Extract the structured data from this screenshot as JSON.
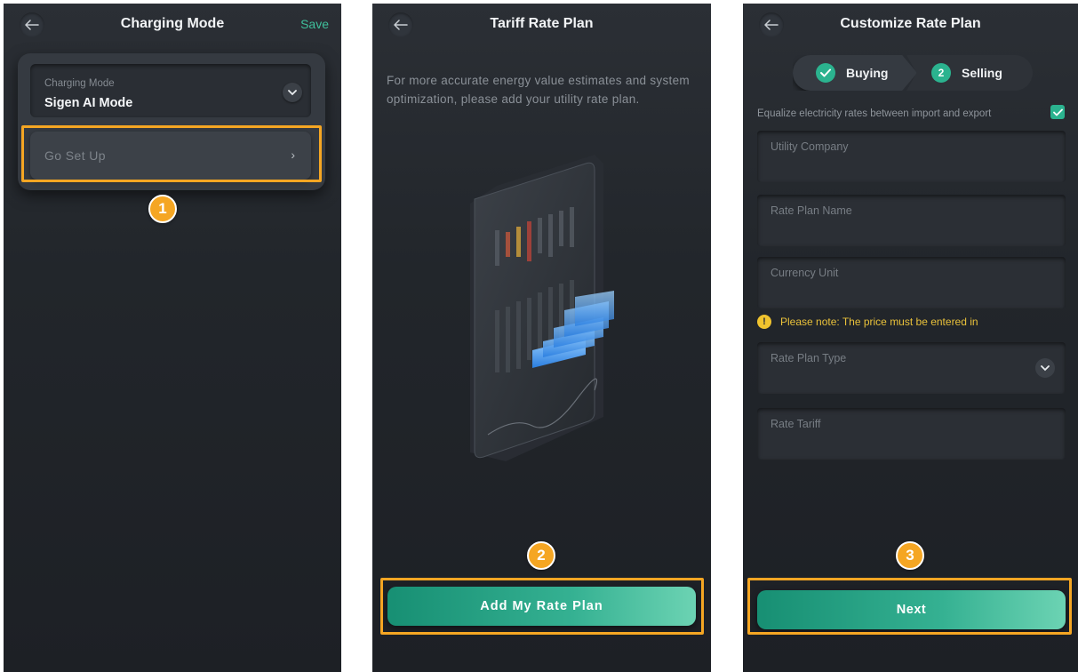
{
  "colors": {
    "accent": "#2bb38f",
    "highlight": "#f5a623",
    "note": "#e9c13a",
    "background": "#22262b"
  },
  "screen1": {
    "title": "Charging Mode",
    "save_label": "Save",
    "charging_mode_label": "Charging Mode",
    "charging_mode_value": "Sigen AI Mode",
    "go_set_up_label": "Go Set Up",
    "step_badge": "1"
  },
  "screen2": {
    "title": "Tariff Rate Plan",
    "description": "For more accurate energy value estimates and system optimization,  please add your utility rate plan.",
    "add_button_label": "Add My Rate Plan",
    "step_badge": "2"
  },
  "screen3": {
    "title": "Customize Rate Plan",
    "steps": [
      {
        "label": "Buying",
        "status": "done",
        "icon": "check-icon"
      },
      {
        "label": "Selling",
        "status": "current",
        "number": "2"
      }
    ],
    "equalize_label": "Equalize electricity rates between import and export",
    "equalize_checked": true,
    "fields": {
      "utility_company": "Utility Company",
      "rate_plan_name": "Rate Plan Name",
      "currency_unit": "Currency Unit",
      "rate_plan_type": "Rate Plan Type",
      "rate_tariff": "Rate Tariff"
    },
    "note_text": "Please note: The price must be entered in",
    "next_label": "Next",
    "step_badge": "3"
  }
}
